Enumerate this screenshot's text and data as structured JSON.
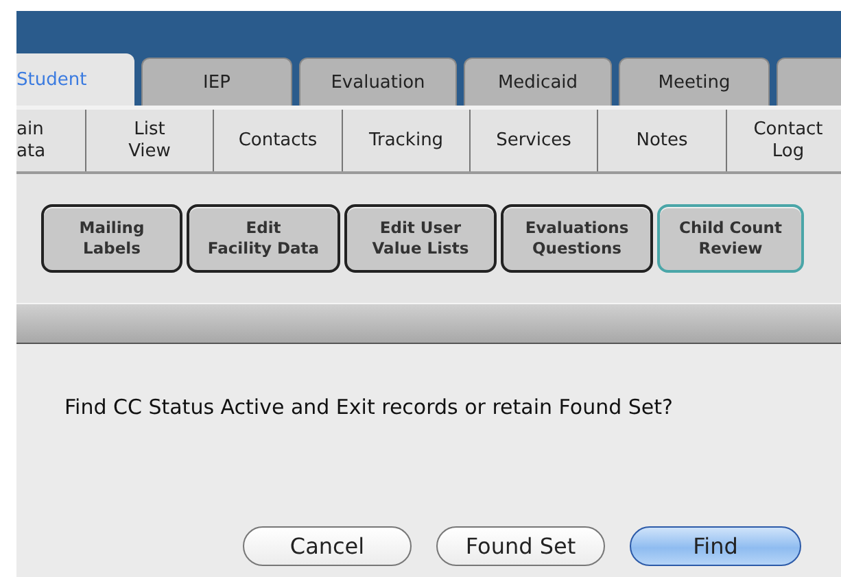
{
  "tabs": [
    {
      "label": "Student",
      "selected": true
    },
    {
      "label": "IEP",
      "selected": false
    },
    {
      "label": "Evaluation",
      "selected": false
    },
    {
      "label": "Medicaid",
      "selected": false
    },
    {
      "label": "Meeting",
      "selected": false
    },
    {
      "selected": false
    }
  ],
  "subtabs": [
    "ain\nata",
    "List\nView",
    "Contacts",
    "Tracking",
    "Services",
    "Notes",
    "Contact\nLog"
  ],
  "actions": [
    {
      "label": "Mailing\nLabels",
      "focused": false
    },
    {
      "label": "Edit\nFacility Data",
      "focused": false
    },
    {
      "label": "Edit User\nValue Lists",
      "focused": false
    },
    {
      "label": "Evaluations\nQuestions",
      "focused": false
    },
    {
      "label": "Child Count\nReview",
      "focused": true
    }
  ],
  "dialog": {
    "message": "Find CC Status Active and Exit records or retain Found Set?",
    "buttons": [
      {
        "label": "Cancel",
        "default": false
      },
      {
        "label": "Found Set",
        "default": false
      },
      {
        "label": "Find",
        "default": true
      }
    ]
  }
}
